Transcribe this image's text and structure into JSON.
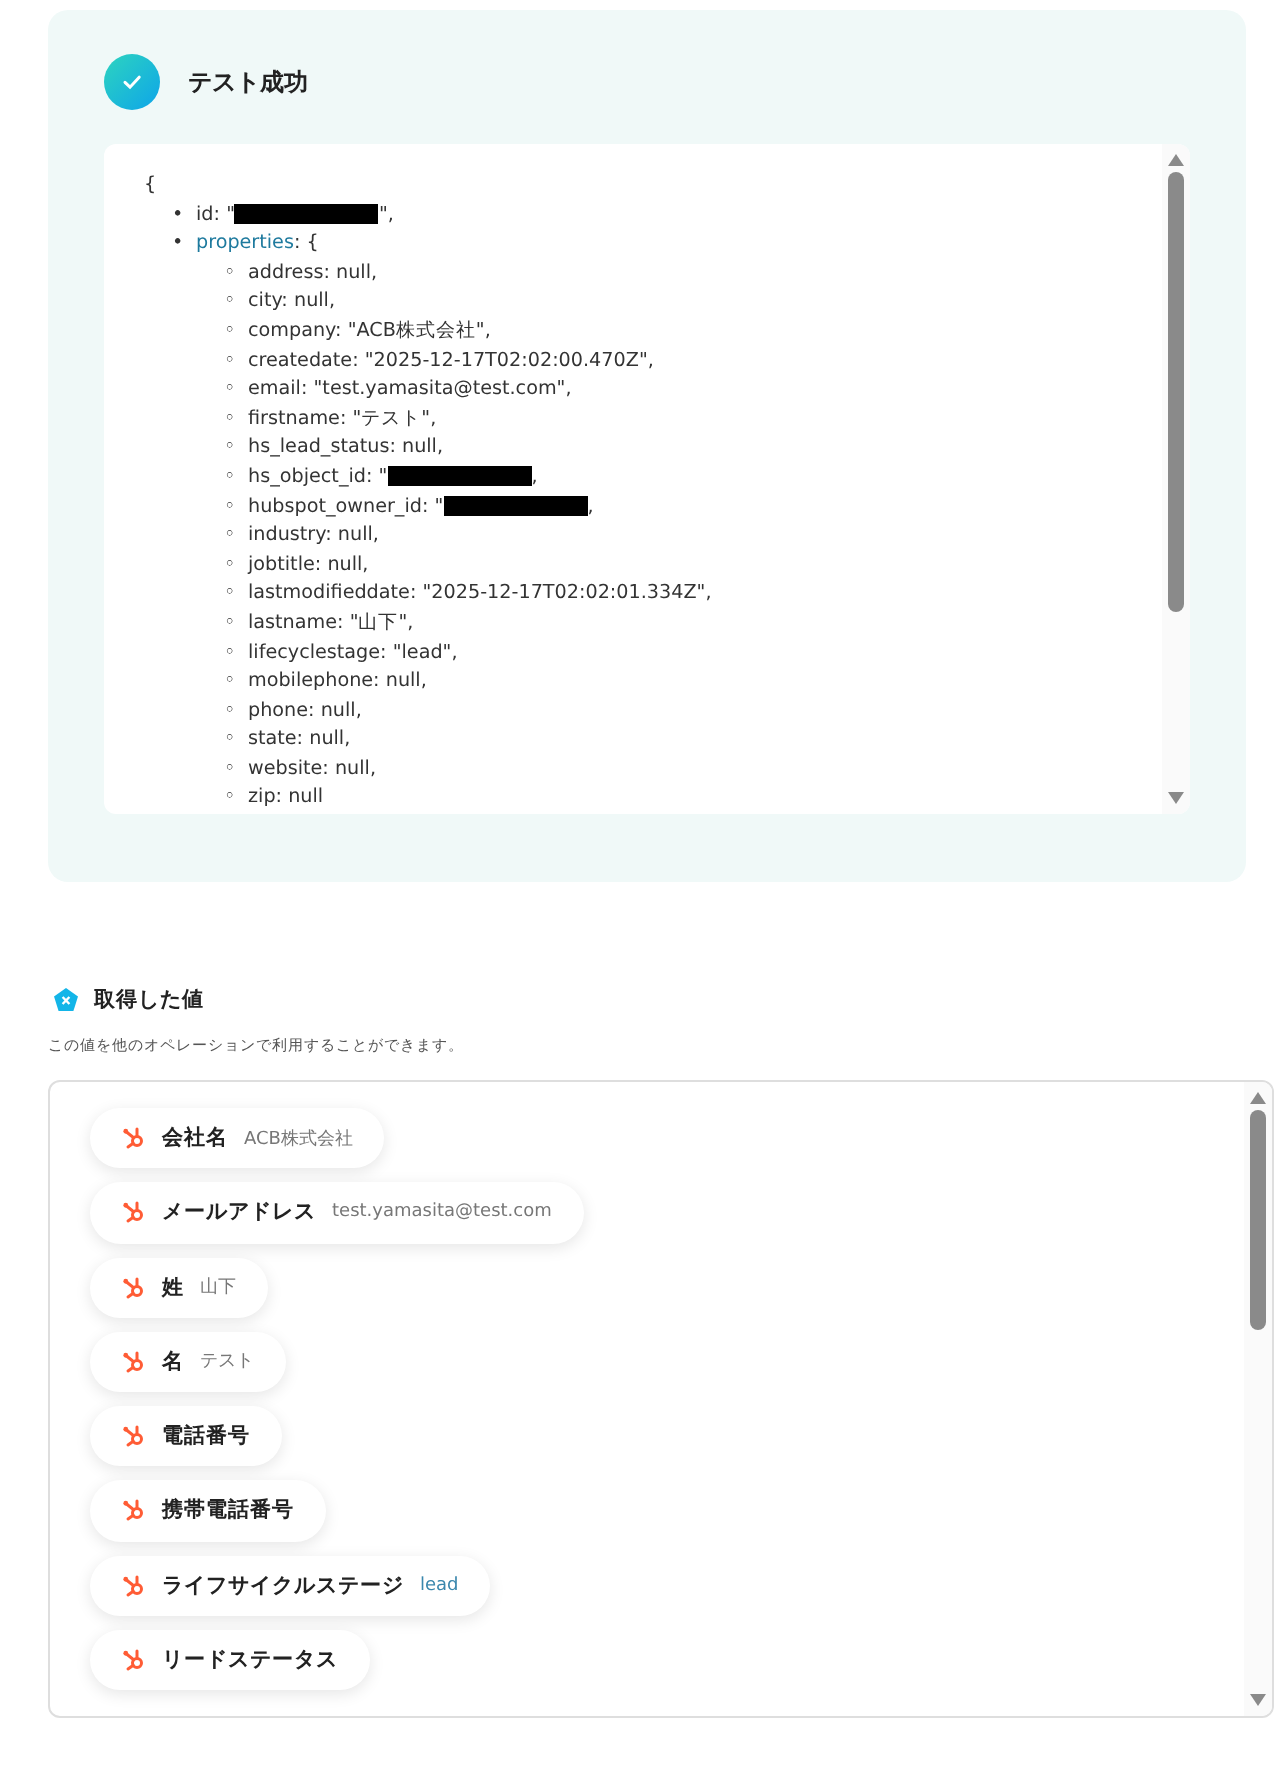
{
  "test_result": {
    "title": "テスト成功",
    "success": true,
    "json_view": {
      "open": "{",
      "lines": [
        {
          "bullet": "•",
          "key": "id:",
          "value": "\"",
          "redacted": true,
          "tail": "\","
        },
        {
          "bullet": "•",
          "key": "properties",
          "kind": "object",
          "value": ": {",
          "children": [
            {
              "bullet": "◦",
              "key": "address:",
              "value": "null,"
            },
            {
              "bullet": "◦",
              "key": "city:",
              "value": "null,"
            },
            {
              "bullet": "◦",
              "key": "company:",
              "value": "\"ACB株式会社\","
            },
            {
              "bullet": "◦",
              "key": "createdate:",
              "value": "\"2025-12-17T02:02:00.470Z\","
            },
            {
              "bullet": "◦",
              "key": "email:",
              "value": "\"test.yamasita@test.com\","
            },
            {
              "bullet": "◦",
              "key": "firstname:",
              "value": "\"テスト\","
            },
            {
              "bullet": "◦",
              "key": "hs_lead_status:",
              "value": "null,"
            },
            {
              "bullet": "◦",
              "key": "hs_object_id:",
              "value": "\"",
              "redacted": true,
              "tail": ","
            },
            {
              "bullet": "◦",
              "key": "hubspot_owner_id:",
              "value": "\"",
              "redacted": true,
              "tail": ","
            },
            {
              "bullet": "◦",
              "key": "industry:",
              "value": "null,"
            },
            {
              "bullet": "◦",
              "key": "jobtitle:",
              "value": "null,"
            },
            {
              "bullet": "◦",
              "key": "lastmodifieddate:",
              "value": "\"2025-12-17T02:02:01.334Z\","
            },
            {
              "bullet": "◦",
              "key": "lastname:",
              "value": "\"山下\","
            },
            {
              "bullet": "◦",
              "key": "lifecyclestage:",
              "value": "\"lead\","
            },
            {
              "bullet": "◦",
              "key": "mobilephone:",
              "value": "null,"
            },
            {
              "bullet": "◦",
              "key": "phone:",
              "value": "null,"
            },
            {
              "bullet": "◦",
              "key": "state:",
              "value": "null,"
            },
            {
              "bullet": "◦",
              "key": "website:",
              "value": "null,"
            },
            {
              "bullet": "◦",
              "key": "zip:",
              "value": "null"
            }
          ]
        }
      ]
    }
  },
  "values_section": {
    "title": "取得した値",
    "description": "この値を他のオペレーションで利用することができます。",
    "items": [
      {
        "label": "会社名",
        "value": "ACB株式会社"
      },
      {
        "label": "メールアドレス",
        "value": "test.yamasita@test.com"
      },
      {
        "label": "姓",
        "value": "山下"
      },
      {
        "label": "名",
        "value": "テスト"
      },
      {
        "label": "電話番号"
      },
      {
        "label": "携帯電話番号"
      },
      {
        "label": "ライフサイクルステージ",
        "value": "lead",
        "kind": "link"
      },
      {
        "label": "リードステータス"
      }
    ]
  }
}
